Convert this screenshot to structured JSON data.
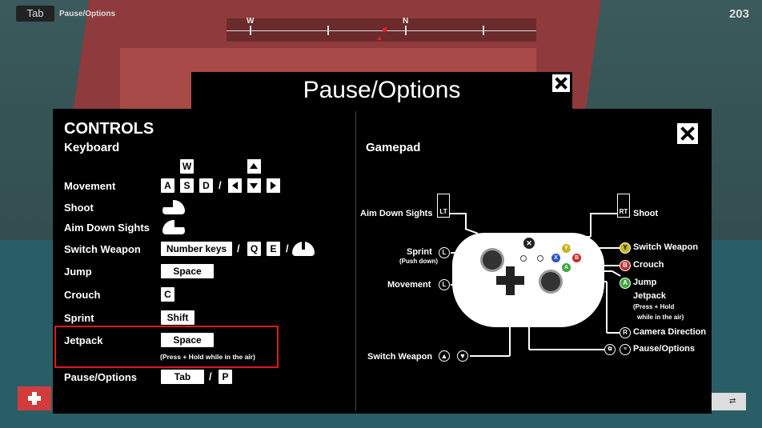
{
  "hud": {
    "tab_key": "Tab",
    "title": "Pause/Options",
    "compass": {
      "west": "W",
      "north": "N"
    },
    "score": "203"
  },
  "modal": {
    "title": "Pause/Options",
    "controls_heading": "CONTROLS",
    "keyboard_heading": "Keyboard",
    "gamepad_heading": "Gamepad"
  },
  "keyboard": {
    "movement": {
      "label": "Movement",
      "up_key": "W",
      "keys": [
        "A",
        "S",
        "D"
      ],
      "separator": "/"
    },
    "shoot": {
      "label": "Shoot"
    },
    "aim": {
      "label": "Aim Down Sights"
    },
    "switch_weapon": {
      "label": "Switch Weapon",
      "keys": [
        "Number keys",
        "Q",
        "E"
      ],
      "separator": "/"
    },
    "jump": {
      "label": "Jump",
      "key": "Space"
    },
    "crouch": {
      "label": "Crouch",
      "key": "C"
    },
    "sprint": {
      "label": "Sprint",
      "key": "Shift"
    },
    "jetpack": {
      "label": "Jetpack",
      "key": "Space",
      "note": "(Press + Hold while in the air)"
    },
    "pause": {
      "label": "Pause/Options",
      "keys": [
        "Tab",
        "P"
      ],
      "separator": "/"
    }
  },
  "gamepad": {
    "aim": "Aim Down Sights",
    "lt": "LT",
    "shoot": "Shoot",
    "rt": "RT",
    "sprint": "Sprint",
    "sprint_sub": "(Push down)",
    "movement": "Movement",
    "l": "L",
    "r": "R",
    "switch_weapon_left": "Switch Weapon",
    "switch_weapon_right": "Switch Weapon",
    "crouch": "Crouch",
    "jump": "Jump",
    "jetpack": "Jetpack",
    "jetpack_sub1": "(Press + Hold",
    "jetpack_sub2": "while in the air)",
    "camera": "Camera Direction",
    "pause": "Pause/Options",
    "y": "Y",
    "b": "B",
    "a": "A",
    "x": "X"
  }
}
